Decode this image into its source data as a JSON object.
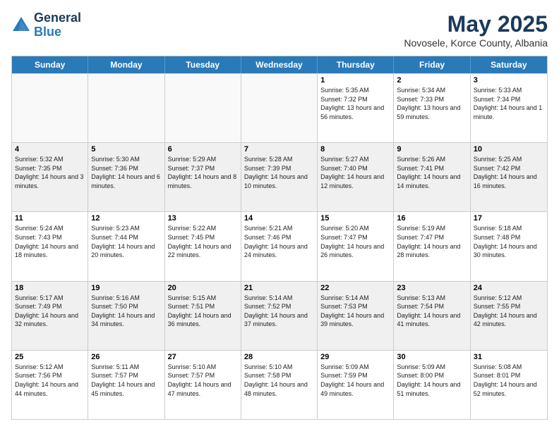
{
  "logo": {
    "general": "General",
    "blue": "Blue"
  },
  "title": "May 2025",
  "subtitle": "Novosele, Korce County, Albania",
  "days": [
    "Sunday",
    "Monday",
    "Tuesday",
    "Wednesday",
    "Thursday",
    "Friday",
    "Saturday"
  ],
  "weeks": [
    [
      {
        "day": "",
        "empty": true
      },
      {
        "day": "",
        "empty": true
      },
      {
        "day": "",
        "empty": true
      },
      {
        "day": "",
        "empty": true
      },
      {
        "day": "1",
        "sunrise": "Sunrise: 5:35 AM",
        "sunset": "Sunset: 7:32 PM",
        "daylight": "Daylight: 13 hours and 56 minutes."
      },
      {
        "day": "2",
        "sunrise": "Sunrise: 5:34 AM",
        "sunset": "Sunset: 7:33 PM",
        "daylight": "Daylight: 13 hours and 59 minutes."
      },
      {
        "day": "3",
        "sunrise": "Sunrise: 5:33 AM",
        "sunset": "Sunset: 7:34 PM",
        "daylight": "Daylight: 14 hours and 1 minute."
      }
    ],
    [
      {
        "day": "4",
        "sunrise": "Sunrise: 5:32 AM",
        "sunset": "Sunset: 7:35 PM",
        "daylight": "Daylight: 14 hours and 3 minutes."
      },
      {
        "day": "5",
        "sunrise": "Sunrise: 5:30 AM",
        "sunset": "Sunset: 7:36 PM",
        "daylight": "Daylight: 14 hours and 6 minutes."
      },
      {
        "day": "6",
        "sunrise": "Sunrise: 5:29 AM",
        "sunset": "Sunset: 7:37 PM",
        "daylight": "Daylight: 14 hours and 8 minutes."
      },
      {
        "day": "7",
        "sunrise": "Sunrise: 5:28 AM",
        "sunset": "Sunset: 7:39 PM",
        "daylight": "Daylight: 14 hours and 10 minutes."
      },
      {
        "day": "8",
        "sunrise": "Sunrise: 5:27 AM",
        "sunset": "Sunset: 7:40 PM",
        "daylight": "Daylight: 14 hours and 12 minutes."
      },
      {
        "day": "9",
        "sunrise": "Sunrise: 5:26 AM",
        "sunset": "Sunset: 7:41 PM",
        "daylight": "Daylight: 14 hours and 14 minutes."
      },
      {
        "day": "10",
        "sunrise": "Sunrise: 5:25 AM",
        "sunset": "Sunset: 7:42 PM",
        "daylight": "Daylight: 14 hours and 16 minutes."
      }
    ],
    [
      {
        "day": "11",
        "sunrise": "Sunrise: 5:24 AM",
        "sunset": "Sunset: 7:43 PM",
        "daylight": "Daylight: 14 hours and 18 minutes."
      },
      {
        "day": "12",
        "sunrise": "Sunrise: 5:23 AM",
        "sunset": "Sunset: 7:44 PM",
        "daylight": "Daylight: 14 hours and 20 minutes."
      },
      {
        "day": "13",
        "sunrise": "Sunrise: 5:22 AM",
        "sunset": "Sunset: 7:45 PM",
        "daylight": "Daylight: 14 hours and 22 minutes."
      },
      {
        "day": "14",
        "sunrise": "Sunrise: 5:21 AM",
        "sunset": "Sunset: 7:46 PM",
        "daylight": "Daylight: 14 hours and 24 minutes."
      },
      {
        "day": "15",
        "sunrise": "Sunrise: 5:20 AM",
        "sunset": "Sunset: 7:47 PM",
        "daylight": "Daylight: 14 hours and 26 minutes."
      },
      {
        "day": "16",
        "sunrise": "Sunrise: 5:19 AM",
        "sunset": "Sunset: 7:47 PM",
        "daylight": "Daylight: 14 hours and 28 minutes."
      },
      {
        "day": "17",
        "sunrise": "Sunrise: 5:18 AM",
        "sunset": "Sunset: 7:48 PM",
        "daylight": "Daylight: 14 hours and 30 minutes."
      }
    ],
    [
      {
        "day": "18",
        "sunrise": "Sunrise: 5:17 AM",
        "sunset": "Sunset: 7:49 PM",
        "daylight": "Daylight: 14 hours and 32 minutes."
      },
      {
        "day": "19",
        "sunrise": "Sunrise: 5:16 AM",
        "sunset": "Sunset: 7:50 PM",
        "daylight": "Daylight: 14 hours and 34 minutes."
      },
      {
        "day": "20",
        "sunrise": "Sunrise: 5:15 AM",
        "sunset": "Sunset: 7:51 PM",
        "daylight": "Daylight: 14 hours and 36 minutes."
      },
      {
        "day": "21",
        "sunrise": "Sunrise: 5:14 AM",
        "sunset": "Sunset: 7:52 PM",
        "daylight": "Daylight: 14 hours and 37 minutes."
      },
      {
        "day": "22",
        "sunrise": "Sunrise: 5:14 AM",
        "sunset": "Sunset: 7:53 PM",
        "daylight": "Daylight: 14 hours and 39 minutes."
      },
      {
        "day": "23",
        "sunrise": "Sunrise: 5:13 AM",
        "sunset": "Sunset: 7:54 PM",
        "daylight": "Daylight: 14 hours and 41 minutes."
      },
      {
        "day": "24",
        "sunrise": "Sunrise: 5:12 AM",
        "sunset": "Sunset: 7:55 PM",
        "daylight": "Daylight: 14 hours and 42 minutes."
      }
    ],
    [
      {
        "day": "25",
        "sunrise": "Sunrise: 5:12 AM",
        "sunset": "Sunset: 7:56 PM",
        "daylight": "Daylight: 14 hours and 44 minutes."
      },
      {
        "day": "26",
        "sunrise": "Sunrise: 5:11 AM",
        "sunset": "Sunset: 7:57 PM",
        "daylight": "Daylight: 14 hours and 45 minutes."
      },
      {
        "day": "27",
        "sunrise": "Sunrise: 5:10 AM",
        "sunset": "Sunset: 7:57 PM",
        "daylight": "Daylight: 14 hours and 47 minutes."
      },
      {
        "day": "28",
        "sunrise": "Sunrise: 5:10 AM",
        "sunset": "Sunset: 7:58 PM",
        "daylight": "Daylight: 14 hours and 48 minutes."
      },
      {
        "day": "29",
        "sunrise": "Sunrise: 5:09 AM",
        "sunset": "Sunset: 7:59 PM",
        "daylight": "Daylight: 14 hours and 49 minutes."
      },
      {
        "day": "30",
        "sunrise": "Sunrise: 5:09 AM",
        "sunset": "Sunset: 8:00 PM",
        "daylight": "Daylight: 14 hours and 51 minutes."
      },
      {
        "day": "31",
        "sunrise": "Sunrise: 5:08 AM",
        "sunset": "Sunset: 8:01 PM",
        "daylight": "Daylight: 14 hours and 52 minutes."
      }
    ]
  ]
}
